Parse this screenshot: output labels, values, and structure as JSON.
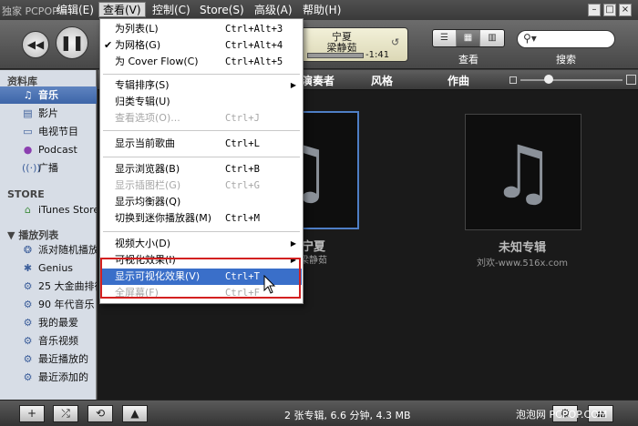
{
  "menubar": {
    "items": [
      {
        "label": "编辑(E)"
      },
      {
        "label": "查看(V)"
      },
      {
        "label": "控制(C)"
      },
      {
        "label": "Store(S)"
      },
      {
        "label": "高级(A)"
      },
      {
        "label": "帮助(H)"
      }
    ],
    "watermark": "独家 PCPOP"
  },
  "toolbar": {
    "lcd_line1": "宁夏",
    "lcd_line2": "梁静茹",
    "lcd_time": "-1:41",
    "view_label": "查看",
    "search_label": "搜索"
  },
  "sidebar": {
    "library_header": "资料库",
    "library": [
      {
        "label": "音乐",
        "icon": "music-note-icon"
      },
      {
        "label": "影片",
        "icon": "film-icon"
      },
      {
        "label": "电视节目",
        "icon": "tv-icon"
      },
      {
        "label": "Podcast",
        "icon": "podcast-icon"
      },
      {
        "label": "广播",
        "icon": "radio-icon"
      }
    ],
    "store_header": "STORE",
    "store": [
      {
        "label": "iTunes Store",
        "icon": "store-icon"
      }
    ],
    "playlist_header": "播放列表",
    "playlists": [
      {
        "label": "派对随机播放",
        "icon": "party-shuffle-icon"
      },
      {
        "label": "Genius",
        "icon": "genius-icon"
      },
      {
        "label": "25 大金曲排行",
        "icon": "smart-playlist-icon"
      },
      {
        "label": "90 年代音乐",
        "icon": "smart-playlist-icon"
      },
      {
        "label": "我的最爱",
        "icon": "smart-playlist-icon"
      },
      {
        "label": "音乐视频",
        "icon": "smart-playlist-icon"
      },
      {
        "label": "最近播放的",
        "icon": "smart-playlist-icon"
      },
      {
        "label": "最近添加的",
        "icon": "smart-playlist-icon"
      }
    ]
  },
  "browser": {
    "columns": [
      "演奏者",
      "风格",
      "作曲"
    ],
    "albums": [
      {
        "title": "宁夏",
        "artist": "梁静茹"
      },
      {
        "title": "未知专辑",
        "artist": "刘欢-www.516x.com"
      }
    ]
  },
  "view_menu": {
    "items": [
      {
        "label": "为列表(L)",
        "shortcut": "Ctrl+Alt+3"
      },
      {
        "label": "为网格(G)",
        "shortcut": "Ctrl+Alt+4",
        "checked": "✔"
      },
      {
        "label": "为 Cover Flow(C)",
        "shortcut": "Ctrl+Alt+5"
      },
      {
        "label": "专辑排序(S)"
      },
      {
        "label": "归类专辑(U)"
      },
      {
        "label": "查看选项(O)...",
        "shortcut": "Ctrl+J"
      },
      {
        "label": "显示当前歌曲",
        "shortcut": "Ctrl+L"
      },
      {
        "label": "显示浏览器(B)",
        "shortcut": "Ctrl+B"
      },
      {
        "label": "显示插图栏(G)",
        "shortcut": "Ctrl+G"
      },
      {
        "label": "显示均衡器(Q)"
      },
      {
        "label": "切换到迷你播放器(M)",
        "shortcut": "Ctrl+M"
      },
      {
        "label": "视频大小(D)"
      },
      {
        "label": "可视化效果(I)"
      },
      {
        "label": "显示可视化效果(V)",
        "shortcut": "Ctrl+T"
      },
      {
        "label": "全屏幕(F)",
        "shortcut": "Ctrl+F"
      }
    ]
  },
  "statusbar": {
    "text": "2 张专辑, 6.6 分钟, 4.3 MB",
    "watermark": "泡泡网 PCPOP.COM"
  }
}
